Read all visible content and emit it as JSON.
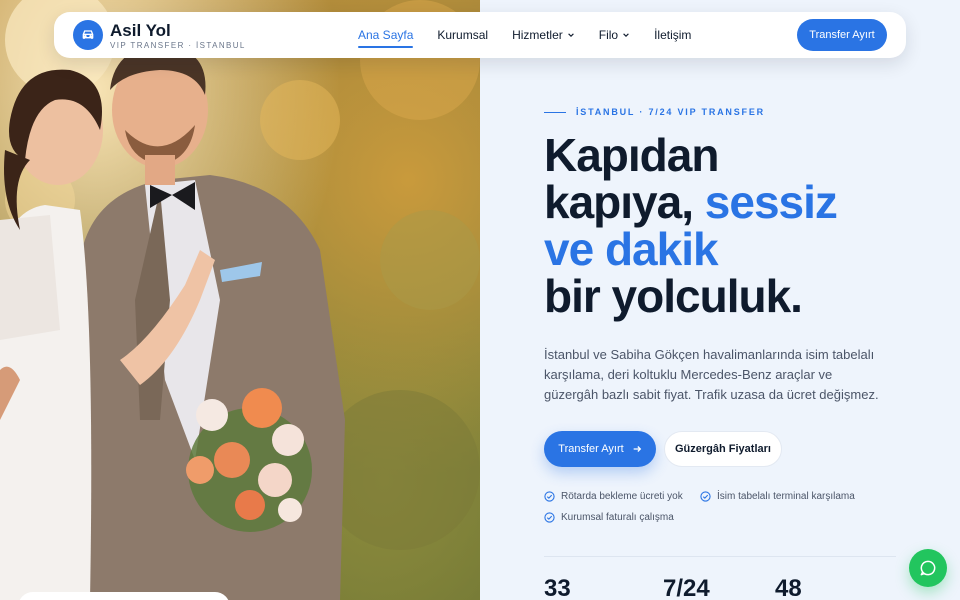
{
  "brand": {
    "name": "Asil Yol",
    "tagline": "VIP TRANSFER · İSTANBUL",
    "logo_icon": "car-icon"
  },
  "nav": {
    "items": [
      {
        "label": "Ana Sayfa",
        "active": true
      },
      {
        "label": "Kurumsal"
      },
      {
        "label": "Hizmetler",
        "dropdown": true
      },
      {
        "label": "Filo",
        "dropdown": true
      },
      {
        "label": "İletişim"
      }
    ],
    "cta_label": "Transfer Ayırt"
  },
  "hero": {
    "kicker": "İSTANBUL · 7/24 VIP TRANSFER",
    "headline": {
      "line1": "Kapıdan",
      "line2a": "kapıya, ",
      "line2b": "sessiz",
      "line3": "ve dakik",
      "line4": "bir yolculuk."
    },
    "description": "İstanbul ve Sabiha Gökçen havalimanlarında isim tabelalı karşılama, deri koltuklu Mercedes-Benz araçlar ve güzergâh bazlı sabit fiyat. Trafik uzasa da ücret değişmez.",
    "primary_cta": "Transfer Ayırt",
    "secondary_cta": "Güzergâh Fiyatları",
    "features": [
      "Rötarda bekleme ücreti yok",
      "İsim tabelalı terminal karşılama",
      "Kurumsal faturalı çalışma"
    ],
    "stats": [
      "33",
      "7/24",
      "48"
    ]
  },
  "colors": {
    "accent": "#2a74e4",
    "dark": "#0f1b2d",
    "chat": "#22c55e"
  }
}
